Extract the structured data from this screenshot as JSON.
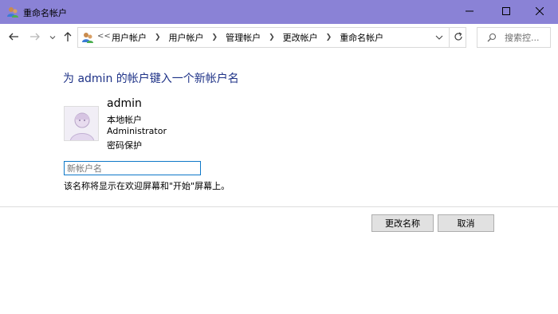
{
  "window": {
    "title": "重命名帐户",
    "controls": [
      "minimize-icon",
      "maximize-icon",
      "close-icon"
    ]
  },
  "nav": {
    "overflow": "<<",
    "breadcrumbs": [
      "用户帐户",
      "用户帐户",
      "管理帐户",
      "更改帐户",
      "重命名帐户"
    ],
    "search_placeholder": "搜索控..."
  },
  "main": {
    "heading": "为 admin 的帐户键入一个新帐户名",
    "account": {
      "name": "admin",
      "lines": [
        "本地帐户",
        "Administrator",
        "密码保护"
      ]
    },
    "new_name_placeholder": "新帐户名",
    "new_name_value": "",
    "note": "该名称将显示在欢迎屏幕和\"开始\"屏幕上。"
  },
  "buttons": {
    "rename": "更改名称",
    "cancel": "取消"
  },
  "colors": {
    "titlebar": "#8a82d6",
    "heading": "#1e3287",
    "input_border": "#0e78c8"
  }
}
